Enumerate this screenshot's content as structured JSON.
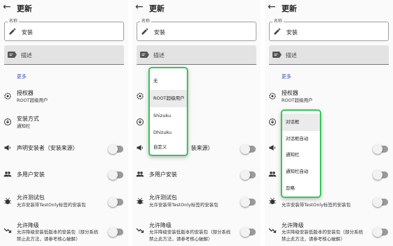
{
  "appbar": {
    "title": "更新"
  },
  "name_field": {
    "label": "名称",
    "value": "安装"
  },
  "desc_field": {
    "value": "描述"
  },
  "more_label": "更多",
  "settings": {
    "authorizer": {
      "title": "授权器",
      "value": "ROOT超级用户"
    },
    "install_method": {
      "title": "安装方式",
      "value": "通知栏"
    },
    "declare_installer": {
      "title": "声明安装者（安装来源）",
      "partial": "装来源）"
    },
    "multi_user": {
      "title": "多用户安装"
    },
    "allow_test": {
      "title": "允许测试包",
      "sub": "允许安装带TestOnly标签的安装包"
    },
    "allow_downgrade": {
      "title": "允许降级",
      "sub1": "允许降级安装低版本的安装包（部分系统",
      "sub2": "禁止此方法，请参考核心破解）"
    }
  },
  "authorizer_menu": {
    "options": [
      "无",
      "ROOT超级用户",
      "Shizuku",
      "Dhizuku",
      "自定义"
    ],
    "selected": "ROOT超级用户"
  },
  "install_method_menu": {
    "options": [
      "对话框",
      "对话框自动",
      "通知栏",
      "通知栏自动",
      "忽略"
    ],
    "selected": "对话框"
  },
  "toggles": {
    "declare_installer": false,
    "multi_user": false,
    "allow_test": false,
    "allow_downgrade": false
  },
  "colors": {
    "highlight": "#34c759",
    "accent": "#3f51b5",
    "toggle_track": "#9a9a9a"
  },
  "icons": {
    "back": "arrow-back-icon",
    "name": "pencil-icon",
    "desc": "label-icon",
    "authorizer": "gear-icon",
    "install_method": "install-icon",
    "declare": "megaphone-icon",
    "multi_user": "people-icon",
    "allow_test": "bug-icon",
    "allow_downgrade": "trending-down-icon"
  }
}
